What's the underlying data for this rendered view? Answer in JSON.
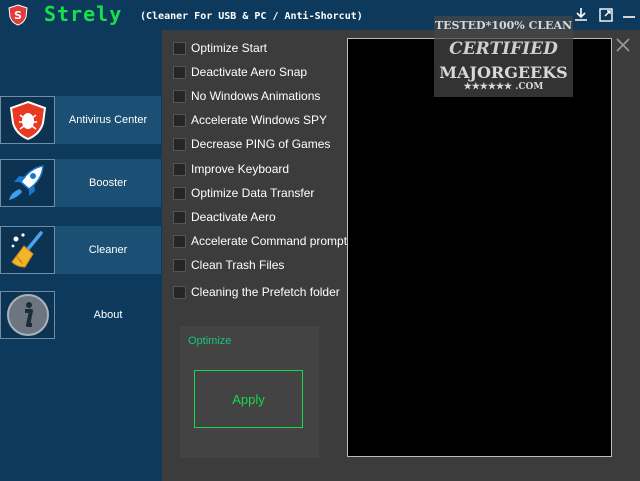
{
  "app": {
    "name": "Strely",
    "subtitle": "(Cleaner For USB & PC / Anti-Shorcut)",
    "colors": {
      "accent": "#17e04a",
      "titlebar": "#0d3a5c",
      "sidebar_active": "#1b4f73"
    }
  },
  "titlebar_icons": [
    "download-icon",
    "maximize-icon",
    "minimize-icon"
  ],
  "sidebar": {
    "items": [
      {
        "label": "Antivirus Center",
        "icon": "antivirus-shield-icon",
        "active": true
      },
      {
        "label": "Booster",
        "icon": "rocket-icon",
        "active": true
      },
      {
        "label": "Cleaner",
        "icon": "broom-icon",
        "active": true
      },
      {
        "label": "About",
        "icon": "info-icon",
        "active": false
      }
    ]
  },
  "options": [
    {
      "label": "Optimize Start",
      "checked": false
    },
    {
      "label": "Deactivate Aero Snap",
      "checked": false
    },
    {
      "label": "No Windows Animations",
      "checked": false
    },
    {
      "label": "Accelerate Windows SPY",
      "checked": false
    },
    {
      "label": "Decrease PING of Games",
      "checked": false
    },
    {
      "label": "Improve Keyboard",
      "checked": false
    },
    {
      "label": "Optimize Data Transfer",
      "checked": false
    },
    {
      "label": "Deactivate Aero",
      "checked": false
    },
    {
      "label": "Accelerate Command prompt",
      "checked": false
    },
    {
      "label": "Clean Trash Files",
      "checked": false
    },
    {
      "label": "Cleaning the Prefetch folder",
      "checked": false
    }
  ],
  "optimize": {
    "group_label": "Optimize",
    "apply_label": "Apply"
  },
  "badge": {
    "line1": "TESTED*100% CLEAN",
    "line2": "CERTIFIED",
    "line3": "MAJORGEEKS",
    "line4": "★★★★★★ .COM"
  }
}
